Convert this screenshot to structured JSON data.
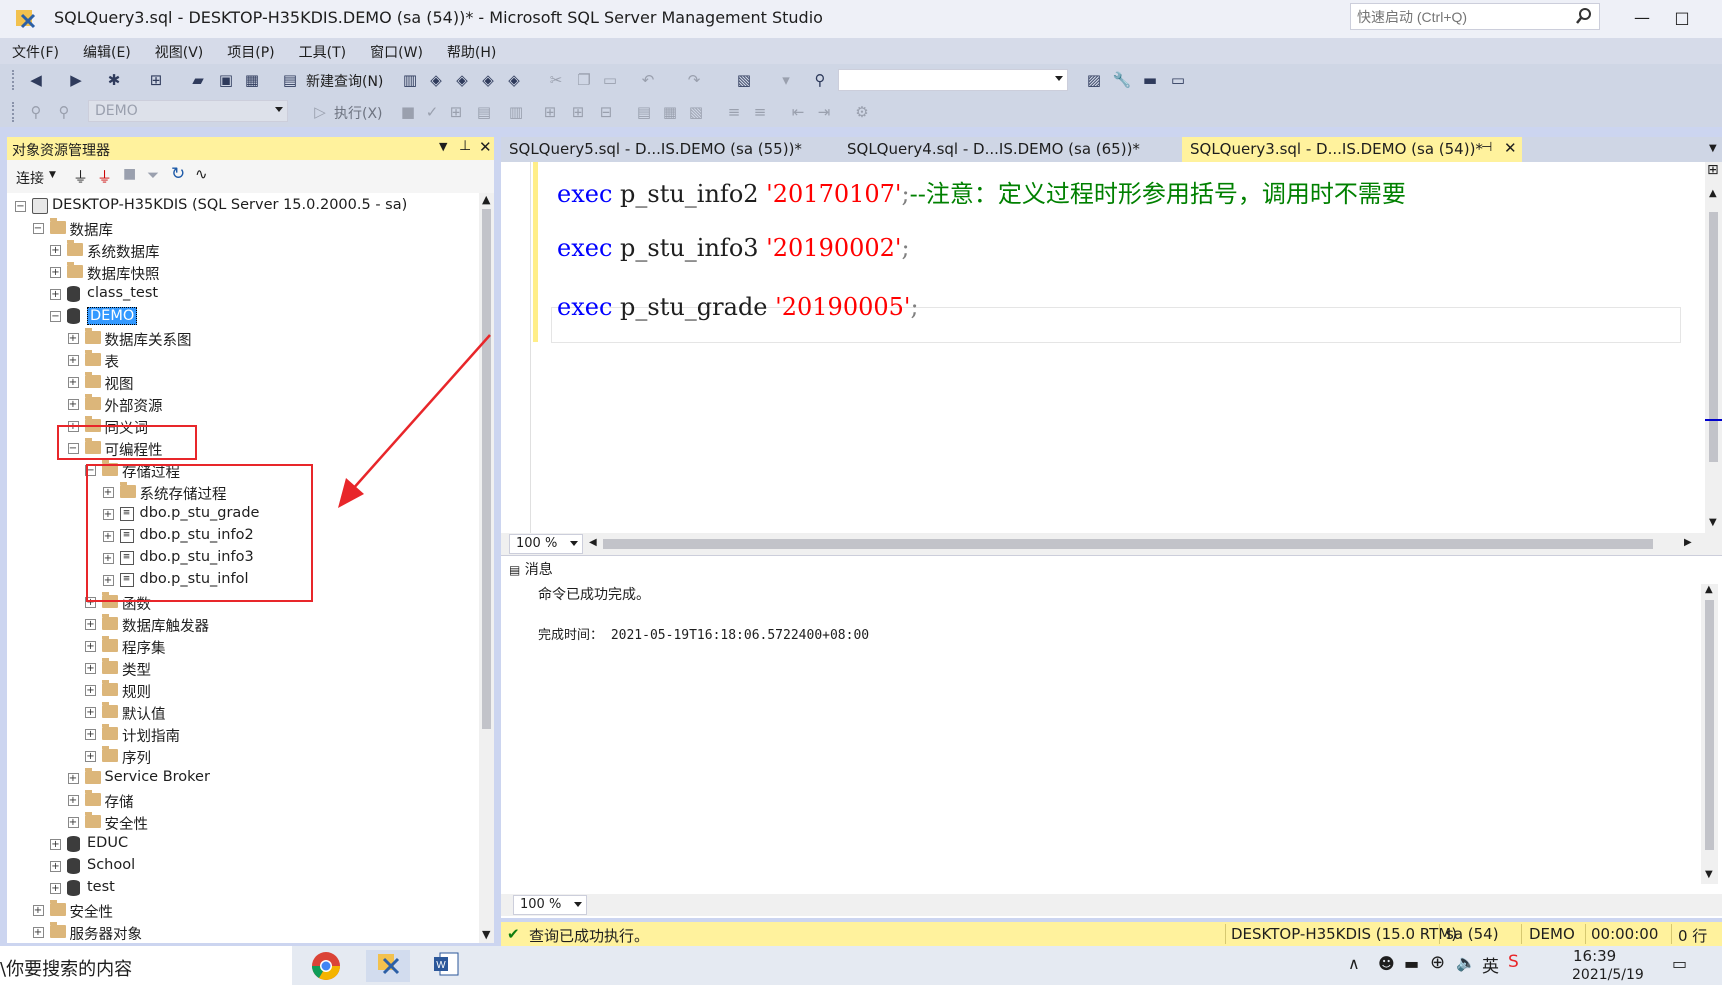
{
  "window": {
    "title": "SQLQuery3.sql - DESKTOP-H35KDIS.DEMO (sa (54))* - Microsoft SQL Server Management Studio",
    "quick_launch_placeholder": "快速启动 (Ctrl+Q)",
    "minimize": "—",
    "maximize": "□"
  },
  "menu": [
    "文件(F)",
    "编辑(E)",
    "视图(V)",
    "项目(P)",
    "工具(T)",
    "窗口(W)",
    "帮助(H)"
  ],
  "toolbar": {
    "new_query_label": "新建查询(N)",
    "execute_label": "执行(X)",
    "database_combo": "DEMO",
    "solution_combo": ""
  },
  "object_explorer": {
    "title": "对象资源管理器",
    "connect_label": "连接",
    "tree": [
      {
        "label": "DESKTOP-H35KDIS (SQL Server 15.0.2000.5 - sa)",
        "icon": "server",
        "level": 0,
        "expanded": true
      },
      {
        "label": "数据库",
        "icon": "folder",
        "level": 1,
        "expanded": true
      },
      {
        "label": "系统数据库",
        "icon": "folder",
        "level": 2,
        "expanded": false
      },
      {
        "label": "数据库快照",
        "icon": "folder",
        "level": 2,
        "expanded": false
      },
      {
        "label": "class_test",
        "icon": "database",
        "level": 2,
        "expanded": false
      },
      {
        "label": "DEMO",
        "icon": "database",
        "level": 2,
        "expanded": true,
        "selected": true
      },
      {
        "label": "数据库关系图",
        "icon": "folder",
        "level": 3,
        "expanded": false
      },
      {
        "label": "表",
        "icon": "folder",
        "level": 3,
        "expanded": false
      },
      {
        "label": "视图",
        "icon": "folder",
        "level": 3,
        "expanded": false
      },
      {
        "label": "外部资源",
        "icon": "folder",
        "level": 3,
        "expanded": false
      },
      {
        "label": "同义词",
        "icon": "folder",
        "level": 3,
        "expanded": false
      },
      {
        "label": "可编程性",
        "icon": "folder",
        "level": 3,
        "expanded": true
      },
      {
        "label": "存储过程",
        "icon": "folder",
        "level": 4,
        "expanded": true
      },
      {
        "label": "系统存储过程",
        "icon": "folder",
        "level": 5,
        "expanded": false
      },
      {
        "label": "dbo.p_stu_grade",
        "icon": "procedure",
        "level": 5,
        "expanded": false
      },
      {
        "label": "dbo.p_stu_info2",
        "icon": "procedure",
        "level": 5,
        "expanded": false
      },
      {
        "label": "dbo.p_stu_info3",
        "icon": "procedure",
        "level": 5,
        "expanded": false
      },
      {
        "label": "dbo.p_stu_infol",
        "icon": "procedure",
        "level": 5,
        "expanded": false
      },
      {
        "label": "函数",
        "icon": "folder",
        "level": 4,
        "expanded": false
      },
      {
        "label": "数据库触发器",
        "icon": "folder",
        "level": 4,
        "expanded": false
      },
      {
        "label": "程序集",
        "icon": "folder",
        "level": 4,
        "expanded": false
      },
      {
        "label": "类型",
        "icon": "folder",
        "level": 4,
        "expanded": false
      },
      {
        "label": "规则",
        "icon": "folder",
        "level": 4,
        "expanded": false
      },
      {
        "label": "默认值",
        "icon": "folder",
        "level": 4,
        "expanded": false
      },
      {
        "label": "计划指南",
        "icon": "folder",
        "level": 4,
        "expanded": false
      },
      {
        "label": "序列",
        "icon": "folder",
        "level": 4,
        "expanded": false
      },
      {
        "label": "Service Broker",
        "icon": "folder",
        "level": 3,
        "expanded": false
      },
      {
        "label": "存储",
        "icon": "folder",
        "level": 3,
        "expanded": false
      },
      {
        "label": "安全性",
        "icon": "folder",
        "level": 3,
        "expanded": false
      },
      {
        "label": "EDUC",
        "icon": "database",
        "level": 2,
        "expanded": false
      },
      {
        "label": "School",
        "icon": "database",
        "level": 2,
        "expanded": false
      },
      {
        "label": "test",
        "icon": "database",
        "level": 2,
        "expanded": false
      },
      {
        "label": "安全性",
        "icon": "folder",
        "level": 1,
        "expanded": false
      },
      {
        "label": "服务器对象",
        "icon": "folder",
        "level": 1,
        "expanded": false
      }
    ]
  },
  "tabs": [
    {
      "label": "SQLQuery5.sql - D...IS.DEMO (sa (55))*",
      "active": false
    },
    {
      "label": "SQLQuery4.sql - D...IS.DEMO (sa (65))*",
      "active": false
    },
    {
      "label": "SQLQuery3.sql - D...IS.DEMO (sa (54))*",
      "active": true
    }
  ],
  "editor": {
    "lines": [
      {
        "kw": "exec",
        "name": " p_stu_info2 ",
        "str": "'20170107'",
        "tail": ";",
        "comment": "--注意：定义过程时形参用括号，调用时不需要"
      },
      {
        "kw": "exec",
        "name": " p_stu_info3 ",
        "str": "'20190002'",
        "tail": ";",
        "comment": ""
      },
      {
        "kw": "exec",
        "name": " p_stu_grade ",
        "str": "'20190005'",
        "tail": ";",
        "comment": ""
      }
    ],
    "zoom": "100 %"
  },
  "results": {
    "tab_label": "消息",
    "message": "命令已成功完成。",
    "completion_time": "完成时间： 2021-05-19T16:18:06.5722400+08:00",
    "zoom": "100 %"
  },
  "status": {
    "message": "查询已成功执行。",
    "server": "DESKTOP-H35KDIS (15.0 RTM)",
    "user": "sa (54)",
    "database": "DEMO",
    "elapsed": "00:00:00",
    "rows": "0 行"
  },
  "taskbar": {
    "search_text": "\\你要搜索的内容",
    "time": "16:39",
    "date": "2021/5/19"
  },
  "colors": {
    "annotation": "#E8262A",
    "keyword": "#0000FF",
    "string": "#FF0000",
    "comment": "#008000",
    "active_tab": "#FFF29D"
  }
}
